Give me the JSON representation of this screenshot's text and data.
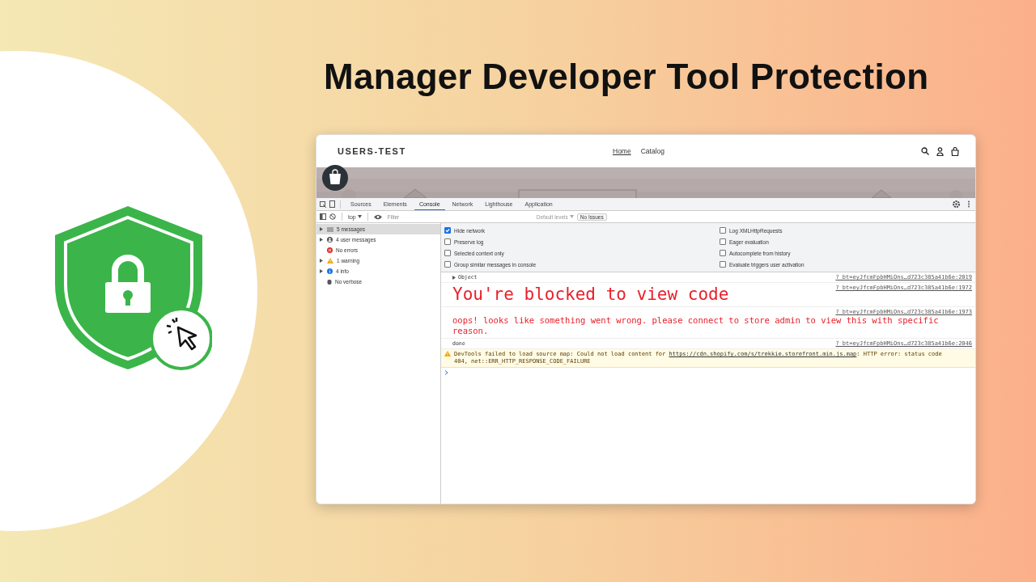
{
  "title": "Manager Developer Tool Protection",
  "store": {
    "name": "USERS-TEST",
    "nav": [
      {
        "label": "Home",
        "selected": true
      },
      {
        "label": "Catalog",
        "selected": false
      }
    ]
  },
  "devtools": {
    "tabs": [
      {
        "label": "Sources",
        "selected": false
      },
      {
        "label": "Elements",
        "selected": false
      },
      {
        "label": "Console",
        "selected": true
      },
      {
        "label": "Network",
        "selected": false
      },
      {
        "label": "Lighthouse",
        "selected": false
      },
      {
        "label": "Application",
        "selected": false
      }
    ],
    "context": "top",
    "filter_placeholder": "Filter",
    "levels": "Default levels",
    "issues": "No Issues",
    "sidebar": [
      {
        "kind": "list",
        "label": "5 messages",
        "selected": true,
        "expandable": true
      },
      {
        "kind": "user",
        "label": "4 user messages",
        "selected": false,
        "expandable": true
      },
      {
        "kind": "error",
        "label": "No errors",
        "selected": false,
        "expandable": false
      },
      {
        "kind": "warning",
        "label": "1 warning",
        "selected": false,
        "expandable": true
      },
      {
        "kind": "info",
        "label": "4 info",
        "selected": false,
        "expandable": true
      },
      {
        "kind": "verbose",
        "label": "No verbose",
        "selected": false,
        "expandable": false
      }
    ],
    "settings_left": [
      {
        "label": "Hide network",
        "checked": true
      },
      {
        "label": "Preserve log",
        "checked": false
      },
      {
        "label": "Selected context only",
        "checked": false
      },
      {
        "label": "Group similar messages in console",
        "checked": false
      }
    ],
    "settings_right": [
      {
        "label": "Log XMLHttpRequests",
        "checked": false
      },
      {
        "label": "Eager evaluation",
        "checked": false
      },
      {
        "label": "Autocomplete from history",
        "checked": false
      },
      {
        "label": "Evaluate triggers user activation",
        "checked": false
      }
    ],
    "messages": [
      {
        "kind": "object",
        "text": "Object",
        "source": "?_bt=eyJfcmFpbHMiOns…d723c385a41b6e:2019"
      },
      {
        "kind": "heading",
        "text": "You're blocked to view code",
        "source": "?_bt=eyJfcmFpbHMiOns…d723c385a41b6e:1972"
      },
      {
        "kind": "error-text",
        "text": "oops! looks like something went wrong. please connect to store admin to view this with specific reason.",
        "source": "?_bt=eyJfcmFpbHMiOns…d723c385a41b6e:1973"
      },
      {
        "kind": "log",
        "text": "done",
        "source": "?_bt=eyJfcmFpbHMiOns…d723c385a41b6e:2046"
      },
      {
        "kind": "warning",
        "text": "DevTools failed to load source map: Could not load content for ",
        "link": "https://cdn.shopify.com/s/trekkie.storefront.min.js.map",
        "after": ": HTTP error: status code 404, net::ERR_HTTP_RESPONSE_CODE_FAILURE"
      }
    ]
  }
}
